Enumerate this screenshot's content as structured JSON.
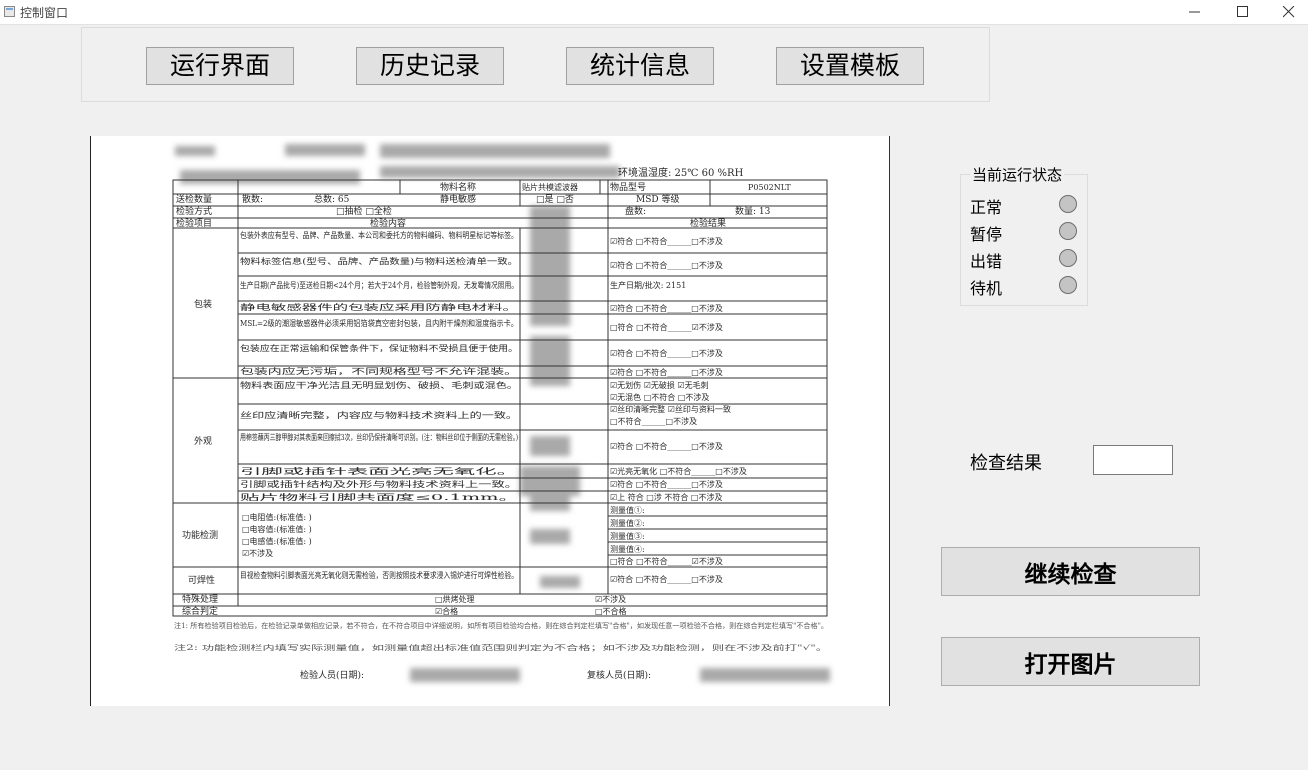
{
  "window": {
    "title": "控制窗口"
  },
  "tabs": [
    {
      "label": "运行界面"
    },
    {
      "label": "历史记录"
    },
    {
      "label": "统计信息"
    },
    {
      "label": "设置模板"
    }
  ],
  "status": {
    "title": "当前运行状态",
    "items": [
      {
        "label": "正常"
      },
      {
        "label": "暂停"
      },
      {
        "label": "出错"
      },
      {
        "label": "待机"
      }
    ]
  },
  "result": {
    "label": "检查结果",
    "value": ""
  },
  "buttons": {
    "continue": "继续检查",
    "open_image": "打开图片"
  },
  "image_text": {
    "env": "环境温湿度: 25℃ 60 %RH",
    "inspect_qty": "送检数量",
    "count": "散数:",
    "total": "总数: 65",
    "mat_name": "物料名称",
    "mat_value": "贴片共模滤波器",
    "model": "物品型号",
    "model_value": "P0502NLT",
    "esd": "静电敏感",
    "yes_no": "□是 □否",
    "msd": "MSD 等级",
    "method": "检验方式",
    "method_opts": "□抽检 □全检",
    "boxes": "盘数:",
    "qty": "数量: 13",
    "item": "检验项目",
    "content": "检验内容",
    "result": "检验结果",
    "cat_pack": "包装",
    "cat_look": "外观",
    "cat_func": "功能检测",
    "cat_solder": "可焊性",
    "special": "特殊处理",
    "overall": "综合判定",
    "c1": "包装外表应有型号、品牌、产品数量、本公司和委托方的物料编码、物料明星标记等标签。",
    "c2": "物料标签信息(型号、品牌、产品数量)与物料送检清单一致。",
    "c3": "生产日期(产品批号)至送检日期<24个月；若大于24个月，检验管制外观，无发霉情况照用。",
    "c4": "静电敏感器件的包装应采用防静电材料。",
    "c5": "MSL=2级的潮湿敏感器件必须采用铝箔袋真空密封包装，且内附干燥剂和湿度指示卡。",
    "c6": "包装应在正常运输和保管条件下，保证物料不受损且便于使用。",
    "c7": "包装内应无污垢，不同规格型号不允许混装。",
    "c8": "物料表面应干净光洁且无明显划伤、破损、毛刺或混色。",
    "c9": "丝印应清晰完整，内容应与物料技术资料上的一致。",
    "c10": "用棉签蘸丙三醇甲醇对其表面来回擦拭3次，丝印仍保持清晰可识别。(注：物料丝印位于侧面的无需检验。)",
    "c11": "引脚或插针表面光亮无氧化。",
    "c12": "引脚或插针结构及外形与物料技术资料上一致。",
    "c13": "贴片物料引脚共面度≤0.1mm。",
    "f1": "□电阻值:(标准值: )",
    "f2": "□电容值:(标准值: )",
    "f3": "□电感值:(标准值: )",
    "f4": "☑不涉及",
    "s1": "目视检查物料引脚表面光亮无氧化则无需检验，否则按照技术要求浸入锡炉进行可焊性检验。",
    "r_ok": "☑符合 □不符合______□不涉及",
    "r_ok2": "☑符合 □不符合______□不涉及",
    "r_date": "生产日期/批次: 2151",
    "r_na": "□符合 □不符合______☑不涉及",
    "r_look1": "☑无划伤 ☑无破损 ☑无毛刺",
    "r_look2": "☑无混色 □不符合 □不涉及",
    "r_look3": "☑丝印清晰完整 ☑丝印与资料一致",
    "r_look4": "□不符合______□不涉及",
    "r_ox": "☑光亮无氧化 □不符合______□不涉及",
    "r_pin": "☑符合 □不符合______□不涉及",
    "r_flat": "☑上 符合 □涉 不符合 □不涉及",
    "m1": "测量值①:",
    "m2": "测量值②:",
    "m3": "测量值③:",
    "m4": "测量值④:",
    "sp_opt": "□烘烤处理",
    "sp_na": "☑不涉及",
    "ov_ok": "☑合格",
    "ov_ng": "□不合格",
    "note1": "注1: 所有检验项目检验后，在检验记录单做相应记录，若不符合，在不符合项目中详细说明，如所有项目检验均合格，则在综合判定栏填写\"合格\"，如发现任意一项检验不合格，则在综合判定栏填写\"不合格\"。",
    "note2": "注2: 功能检测栏内填写实际测量值，如测量值超出标准值范围则判定为不合格；如不涉及功能检测，则在不涉及前打\"√\"。",
    "sign1": "检验人员(日期):",
    "sign2": "复核人员(日期):"
  }
}
